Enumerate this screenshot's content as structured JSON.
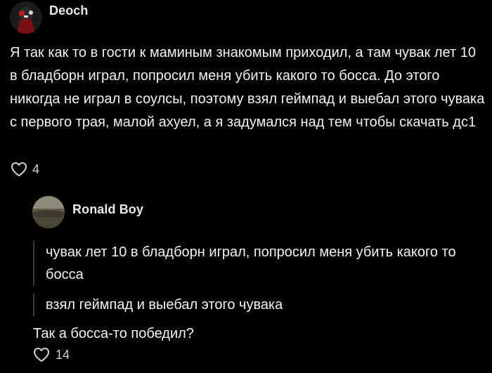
{
  "comments": [
    {
      "author": "Deoch",
      "text": "Я так как то в гости к маминым знакомым приходил, а там чувак лет 10 в бладборн играл, попросил меня убить какого то босса. До этого никогда не играл в соулсы, поэтому взял геймпад и выебал этого чувака с первого трая, малой ахуел, а я задумался над тем чтобы скачать дс1",
      "likes": "4"
    }
  ],
  "reply": {
    "author": "Ronald Boy",
    "quotes": [
      "чувак лет 10 в бладборн играл, попросил меня убить какого то босса",
      "взял геймпад и выебал этого чувака"
    ],
    "text": "Так а босса-то победил?",
    "likes": "14"
  },
  "colors": {
    "background": "#000000",
    "text": "#f2f2f2",
    "quote_bar": "#3a3a3a"
  },
  "icons": {
    "like": "heart-outline-icon"
  }
}
